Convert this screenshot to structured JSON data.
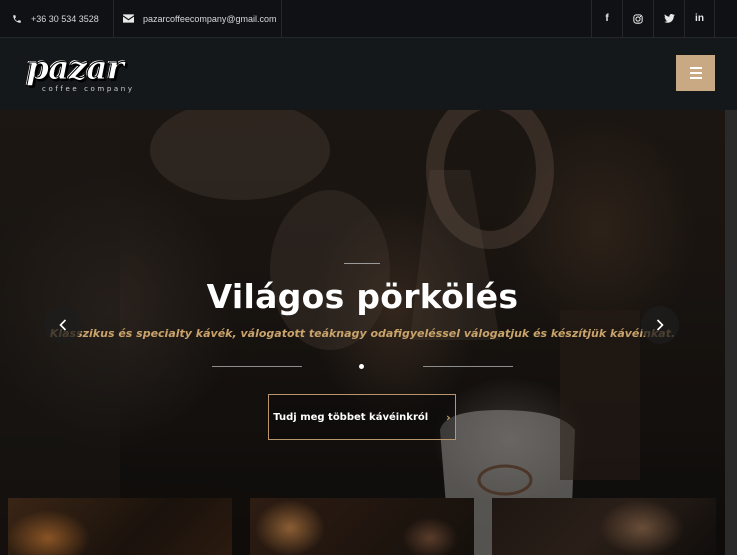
{
  "topbar": {
    "phone": "+36 30 534 3528",
    "email": "pazarcoffeecompany@gmail.com",
    "social": [
      {
        "icon": "facebook-icon",
        "glyph": "f"
      },
      {
        "icon": "instagram-icon",
        "glyph": "◎"
      },
      {
        "icon": "twitter-icon",
        "glyph": "🐦"
      },
      {
        "icon": "linkedin-icon",
        "glyph": "in"
      }
    ]
  },
  "header": {
    "logo_word": "pazar",
    "logo_sub": "coffee company",
    "menu_icon": "hamburger-menu-icon",
    "accent_color": "#c9a983"
  },
  "hero": {
    "title": "Világos pörkölés",
    "subtitle": "Klasszikus és specialty kávék, válogatott teáknagy odafigyeléssel válogatjuk és készítjük kávéinkat.",
    "cta_label": "Tudj meg többet kávéinkról",
    "cta_arrow": "›",
    "prev_icon": "chevron-left-icon",
    "next_icon": "chevron-right-icon",
    "subtitle_color": "#c9a36a"
  }
}
